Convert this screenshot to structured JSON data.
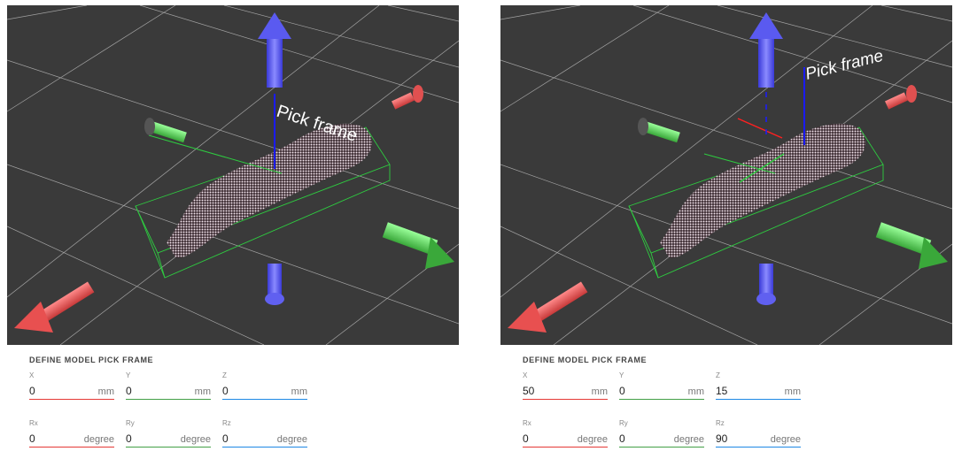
{
  "panels": [
    {
      "label_3d": "Pick frame",
      "title": "DEFINE MODEL PICK FRAME",
      "fields": [
        {
          "label": "X",
          "value": "0",
          "unit": "mm"
        },
        {
          "label": "Y",
          "value": "0",
          "unit": "mm"
        },
        {
          "label": "Z",
          "value": "0",
          "unit": "mm"
        },
        {
          "label": "Rx",
          "value": "0",
          "unit": "degree"
        },
        {
          "label": "Ry",
          "value": "0",
          "unit": "degree"
        },
        {
          "label": "Rz",
          "value": "0",
          "unit": "degree"
        }
      ]
    },
    {
      "label_3d": "Pick frame",
      "title": "DEFINE MODEL PICK FRAME",
      "fields": [
        {
          "label": "X",
          "value": "50",
          "unit": "mm"
        },
        {
          "label": "Y",
          "value": "0",
          "unit": "mm"
        },
        {
          "label": "Z",
          "value": "15",
          "unit": "mm"
        },
        {
          "label": "Rx",
          "value": "0",
          "unit": "degree"
        },
        {
          "label": "Ry",
          "value": "0",
          "unit": "degree"
        },
        {
          "label": "Rz",
          "value": "90",
          "unit": "degree"
        }
      ]
    }
  ],
  "colors": {
    "x_axis": "#e53935",
    "y_axis": "#43a047",
    "z_axis": "#1e88e5",
    "viewport_bg": "#3a3a3a"
  }
}
